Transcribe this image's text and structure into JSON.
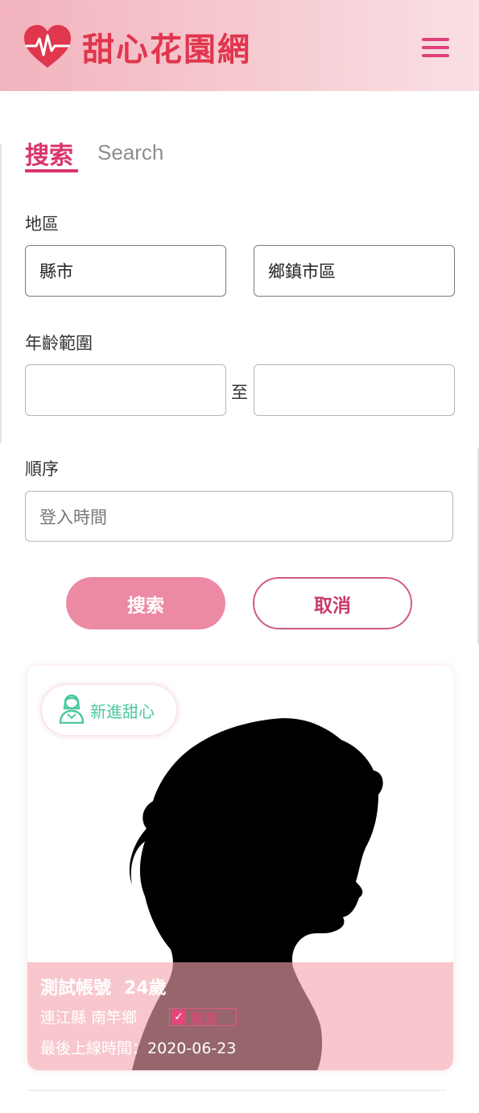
{
  "header": {
    "logo_text": "甜心花園網",
    "logo_icon": "heart-pulse-icon",
    "menu_icon": "hamburger-menu-icon",
    "gradient_colors": [
      "#f2b3bd",
      "#f9e0e4"
    ],
    "accent_color": "#e0364e"
  },
  "search": {
    "title_zh": "搜索",
    "title_en": "Search",
    "region_label": "地區",
    "city_placeholder": "縣市",
    "district_placeholder": "鄉鎮市區",
    "age_label": "年齡範圍",
    "age_min_value": "",
    "age_max_value": "",
    "age_separator": "至",
    "order_label": "順序",
    "order_value": "登入時間",
    "search_button": "搜索",
    "cancel_button": "取消",
    "primary_color": "#ec8aa3",
    "accent_color": "#d9366b"
  },
  "profile_card": {
    "badge_text": "新進甜心",
    "badge_icon": "user-female-icon",
    "badge_color": "#4cc8a0",
    "name": "測試帳號",
    "age": "24歲",
    "location": "連江縣 南竿鄉",
    "job_tag": "職業",
    "last_login_label": "最後上線時間：",
    "last_login_value": "2020-06-23",
    "overlay_color": "#f2a5af"
  }
}
